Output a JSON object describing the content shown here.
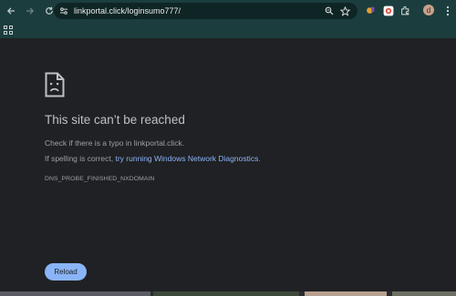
{
  "toolbar": {
    "back_icon": "back-arrow-icon",
    "forward_icon": "forward-arrow-icon",
    "reload_icon": "reload-icon",
    "url": "linkportal.click/loginsumo777/",
    "zoom_icon": "zoom-icon",
    "bookmark_icon": "star-icon",
    "profile_initial": "d"
  },
  "bookmarks_bar": {
    "apps_icon": "apps-grid-icon"
  },
  "error": {
    "icon": "sad-page-icon",
    "title": "This site can’t be reached",
    "check_text": "Check if there is a typo in linkportal.click.",
    "spelling_prefix": "If spelling is correct, ",
    "diagnostics_link": "try running Windows Network Diagnostics",
    "spelling_suffix": ".",
    "error_code": "DNS_PROBE_FINISHED_NXDOMAIN",
    "reload_label": "Reload"
  },
  "colors": {
    "chrome_bg": "#1b3d3d",
    "page_bg": "#202124",
    "link": "#8ab4f8",
    "button_bg": "#8ab4f8"
  }
}
